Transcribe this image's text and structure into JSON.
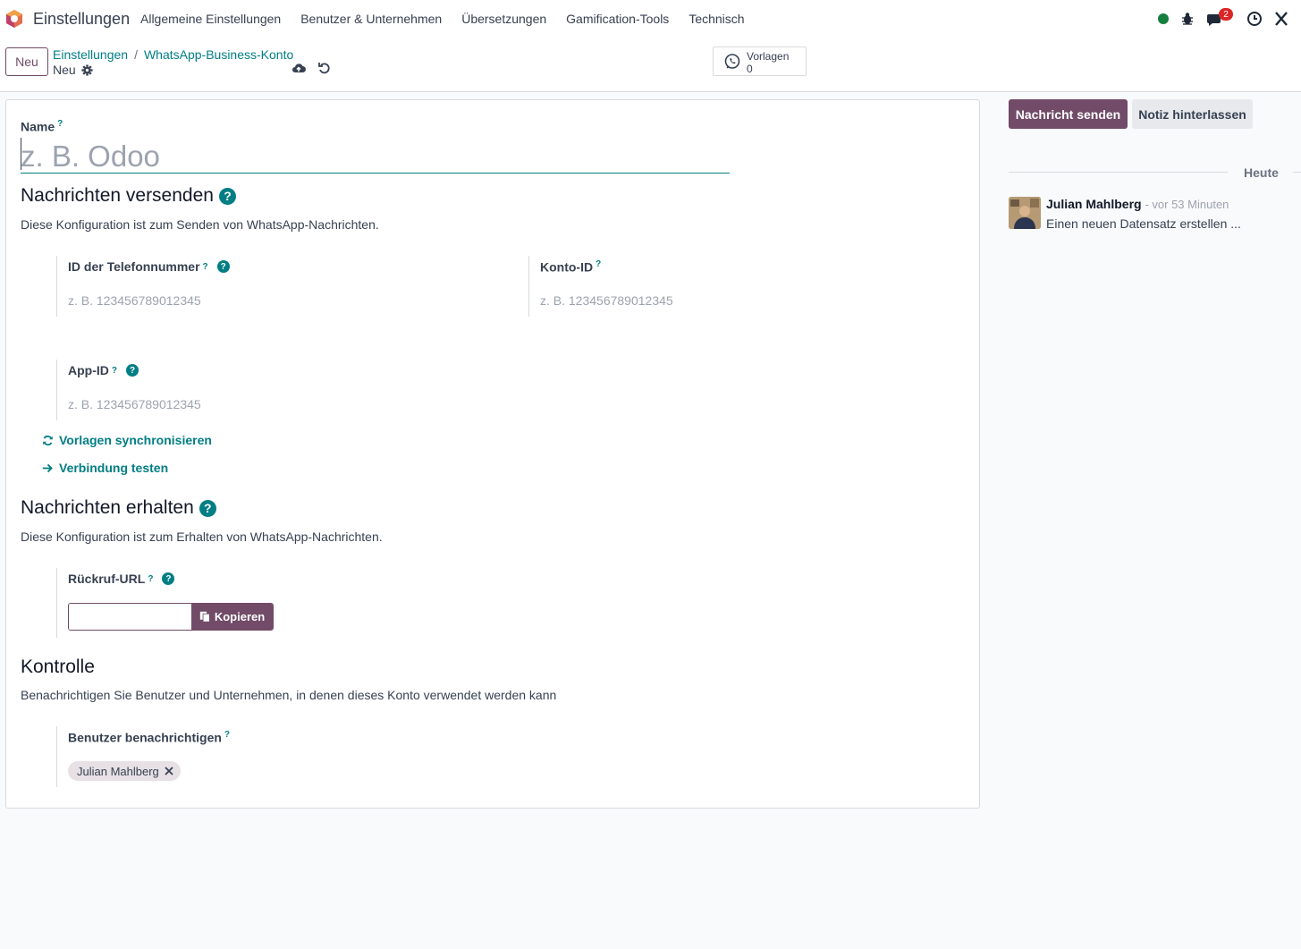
{
  "navbar": {
    "app_title": "Einstellungen",
    "menu": [
      "Allgemeine Einstellungen",
      "Benutzer & Unternehmen",
      "Übersetzungen",
      "Gamification-Tools",
      "Technisch"
    ],
    "messages_badge": "2",
    "status_color": "#15803d"
  },
  "control_panel": {
    "new_label": "Neu",
    "breadcrumb": [
      "Einstellungen",
      "WhatsApp-Business-Konto"
    ],
    "record_name": "Neu",
    "smart_button": {
      "label": "Vorlagen",
      "count": "0"
    }
  },
  "form": {
    "name_label": "Name",
    "help_mark": "?",
    "name_placeholder": "z. B. Odoo",
    "send_section": {
      "title": "Nachrichten versenden",
      "desc": "Diese Konfiguration ist zum Senden von WhatsApp-Nachrichten.",
      "phone_id_label": "ID der Telefonnummer",
      "phone_id_placeholder": "z. B. 123456789012345",
      "account_id_label": "Konto-ID",
      "account_id_placeholder": "z. B. 123456789012345",
      "app_id_label": "App-ID",
      "app_id_placeholder": "z. B. 123456789012345",
      "sync_label": "Vorlagen synchronisieren",
      "test_label": "Verbindung testen"
    },
    "receive_section": {
      "title": "Nachrichten erhalten",
      "desc": "Diese Konfiguration ist zum Erhalten von WhatsApp-Nachrichten.",
      "callback_label": "Rückruf-URL",
      "copy_label": "Kopieren"
    },
    "control_section": {
      "title": "Kontrolle",
      "desc": "Benachrichtigen Sie Benutzer und Unternehmen, in denen dieses Konto verwendet werden kann",
      "notify_label": "Benutzer benachrichtigen",
      "notify_tag": "Julian Mahlberg"
    }
  },
  "chatter": {
    "send_message": "Nachricht senden",
    "log_note": "Notiz hinterlassen",
    "today": "Heute",
    "message": {
      "author": "Julian Mahlberg",
      "time": "- vor 53 Minuten",
      "body": "Einen neuen Datensatz erstellen ..."
    }
  },
  "colors": {
    "primary": "#714b67",
    "link": "#017e84"
  }
}
